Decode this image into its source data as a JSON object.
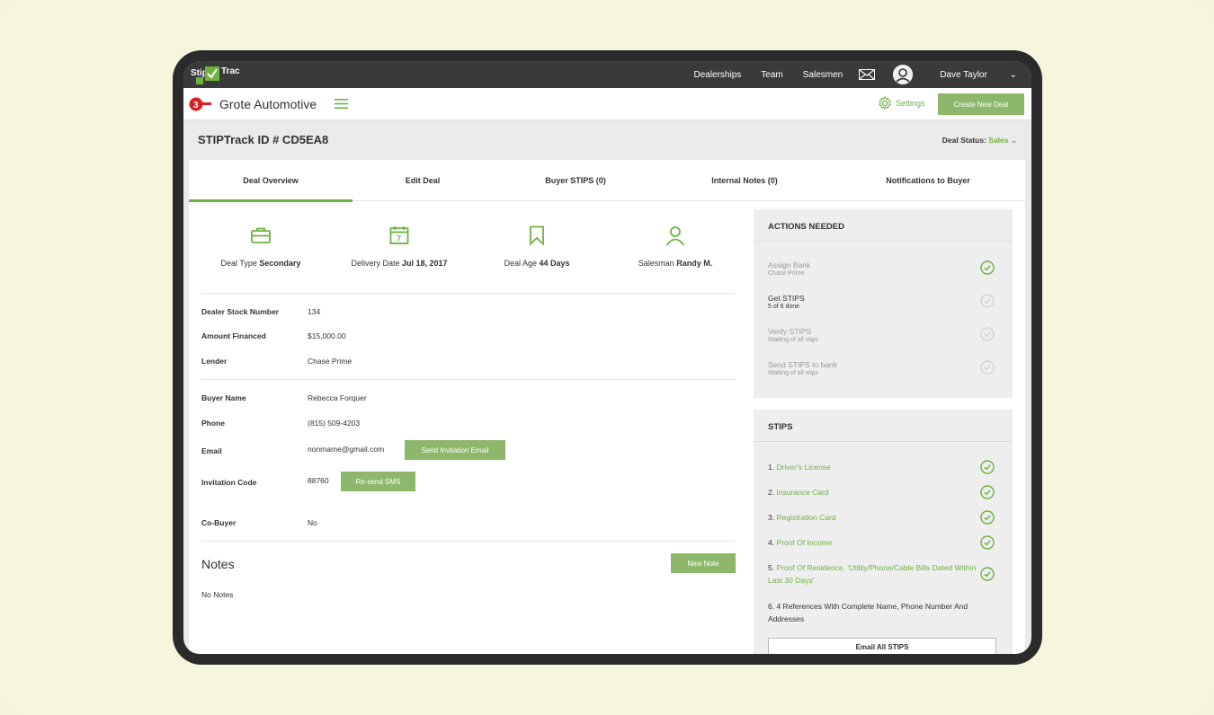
{
  "app": {
    "logo_left": "Stip",
    "logo_right": "Trac",
    "nav": [
      "Dealerships",
      "Team",
      "Salesmen"
    ],
    "user_name": "Dave Taylor",
    "user_caret": "⌄"
  },
  "header": {
    "dealer_name": "Grote Automotive",
    "settings_label": "Settings",
    "create_button": "Create New Deal"
  },
  "deal": {
    "id_title": "STIPTrack ID # CD5EA8",
    "status_label": "Deal Status:",
    "status_value": "Sales",
    "status_caret": "⌄"
  },
  "tabs": [
    "Deal Overview",
    "Edit Deal",
    "Buyer STIPS (0)",
    "Internal Notes (0)",
    "Notifications to Buyer"
  ],
  "summary": [
    {
      "label": "Deal Type",
      "value": "Secondary",
      "icon": "briefcase-icon"
    },
    {
      "label": "Delivery Date",
      "value": "Jul 18, 2017",
      "icon": "calendar-icon"
    },
    {
      "label": "Deal Age",
      "value": "44 Days",
      "icon": "bookmark-icon"
    },
    {
      "label": "Salesman",
      "value": "Randy M.",
      "icon": "person-icon"
    }
  ],
  "calendar_day": "7",
  "details": {
    "stock_label": "Dealer Stock Number",
    "stock_value": "134",
    "amount_label": "Amount Financed",
    "amount_value": "$15,000.00",
    "lender_label": "Lender",
    "lender_value": "Chase Prime",
    "buyer_label": "Buyer Name",
    "buyer_value": "Rebecca Forquer",
    "phone_label": "Phone",
    "phone_value": "(815) 509-4203",
    "email_label": "Email",
    "email_value": "nonmame@gmail.com",
    "send_invite": "Send Invitation Email",
    "code_label": "Invitation Code",
    "code_value": "88760",
    "resend_sms": "Re-send SMS",
    "cobuyer_label": "Co-Buyer",
    "cobuyer_value": "No"
  },
  "notes": {
    "title": "Notes",
    "new_note": "New Note",
    "empty": "No Notes"
  },
  "actions": {
    "title": "ACTIONS NEEDED",
    "items": [
      {
        "title": "Assign Bank",
        "sub": "Chase Prime",
        "done": true
      },
      {
        "title": "Get STIPS",
        "sub": "5 of 6 done",
        "done": false
      },
      {
        "title": "Verify STIPS",
        "sub": "Waiting of all stips",
        "done": false
      },
      {
        "title": "Send STIPS to bank",
        "sub": "Waiting of all stips",
        "done": false
      }
    ]
  },
  "stips": {
    "title": "STIPS",
    "items": [
      {
        "num": "1.",
        "text": "Driver's License",
        "done": true
      },
      {
        "num": "2.",
        "text": "Insurance Card",
        "done": true
      },
      {
        "num": "3.",
        "text": "Registration Card",
        "done": true
      },
      {
        "num": "4.",
        "text": "Proof Of Income",
        "done": true
      },
      {
        "num": "5.",
        "text": "Proof Of Residence. 'Utility/Phone/Cable Bills Dated Within Last 30 Days'",
        "done": true
      },
      {
        "num": "6.",
        "text": "4 References With Complete Name, Phone Number And Addresses",
        "done": false
      }
    ],
    "email_all": "Email All STIPS"
  },
  "colors": {
    "accent": "#6cb33f",
    "button": "#8db86c",
    "topbar": "#3a3a3a"
  }
}
